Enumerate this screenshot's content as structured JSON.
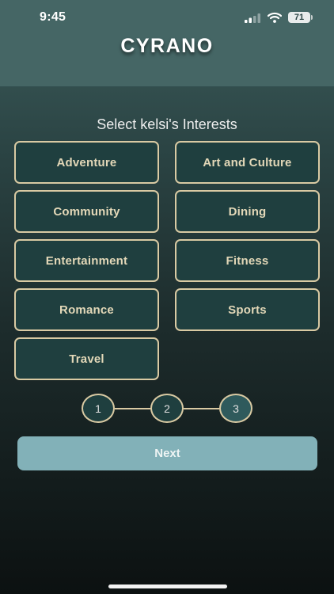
{
  "status_bar": {
    "time": "9:45",
    "battery": "71",
    "signal_icon": "cellular-signal-icon",
    "wifi_icon": "wifi-icon"
  },
  "header": {
    "title": "CYRANO"
  },
  "interests": {
    "title": "Select kelsi's Interests",
    "items": [
      "Adventure",
      "Art and Culture",
      "Community",
      "Dining",
      "Entertainment",
      "Fitness",
      "Romance",
      "Sports",
      "Travel"
    ]
  },
  "stepper": {
    "steps": [
      "1",
      "2",
      "3"
    ],
    "current": 3
  },
  "actions": {
    "next_label": "Next"
  },
  "colors": {
    "accent": "#d9caa3",
    "header": "#456665",
    "tile": "#1f3f3f",
    "button": "#82b1b8"
  }
}
